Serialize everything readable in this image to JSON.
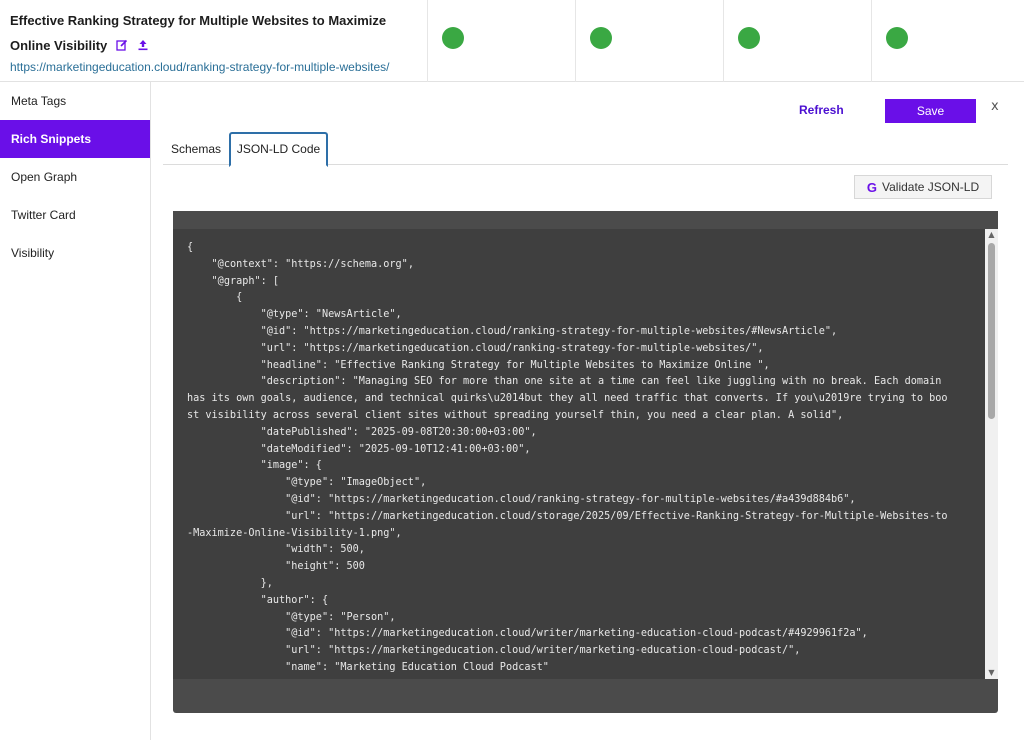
{
  "header": {
    "title": "Effective Ranking Strategy for Multiple Websites to Maximize Online Visibility",
    "url": "https://marketingeducation.cloud/ranking-strategy-for-multiple-websites/",
    "status_color": "#3aa843",
    "title_icons": [
      "edit-icon",
      "upload-icon"
    ]
  },
  "sidebar": {
    "items": [
      {
        "label": "Meta Tags",
        "active": false
      },
      {
        "label": "Rich Snippets",
        "active": true
      },
      {
        "label": "Open Graph",
        "active": false
      },
      {
        "label": "Twitter Card",
        "active": false
      },
      {
        "label": "Visibility",
        "active": false
      }
    ]
  },
  "toolbar": {
    "refresh_label": "Refresh",
    "save_label": "Save",
    "close_label": "x",
    "accent_color": "#6a0fe8"
  },
  "tabs": [
    {
      "label": "Schemas",
      "active": false
    },
    {
      "label": "JSON-LD Code",
      "active": true
    }
  ],
  "validate": {
    "label": "Validate JSON-LD",
    "icon": "G"
  },
  "code": {
    "text": "{\n    \"@context\": \"https://schema.org\",\n    \"@graph\": [\n        {\n            \"@type\": \"NewsArticle\",\n            \"@id\": \"https://marketingeducation.cloud/ranking-strategy-for-multiple-websites/#NewsArticle\",\n            \"url\": \"https://marketingeducation.cloud/ranking-strategy-for-multiple-websites/\",\n            \"headline\": \"Effective Ranking Strategy for Multiple Websites to Maximize Online \",\n            \"description\": \"Managing SEO for more than one site at a time can feel like juggling with no break. Each domain has its own goals, audience, and technical quirks\\u2014but they all need traffic that converts. If you\\u2019re trying to boost visibility across several client sites without spreading yourself thin, you need a clear plan. A solid\",\n            \"datePublished\": \"2025-09-08T20:30:00+03:00\",\n            \"dateModified\": \"2025-09-10T12:41:00+03:00\",\n            \"image\": {\n                \"@type\": \"ImageObject\",\n                \"@id\": \"https://marketingeducation.cloud/ranking-strategy-for-multiple-websites/#a439d884b6\",\n                \"url\": \"https://marketingeducation.cloud/storage/2025/09/Effective-Ranking-Strategy-for-Multiple-Websites-to-Maximize-Online-Visibility-1.png\",\n                \"width\": 500,\n                \"height\": 500\n            },\n            \"author\": {\n                \"@type\": \"Person\",\n                \"@id\": \"https://marketingeducation.cloud/writer/marketing-education-cloud-podcast/#4929961f2a\",\n                \"url\": \"https://marketingeducation.cloud/writer/marketing-education-cloud-podcast/\",\n                \"name\": \"Marketing Education Cloud Podcast\""
  }
}
